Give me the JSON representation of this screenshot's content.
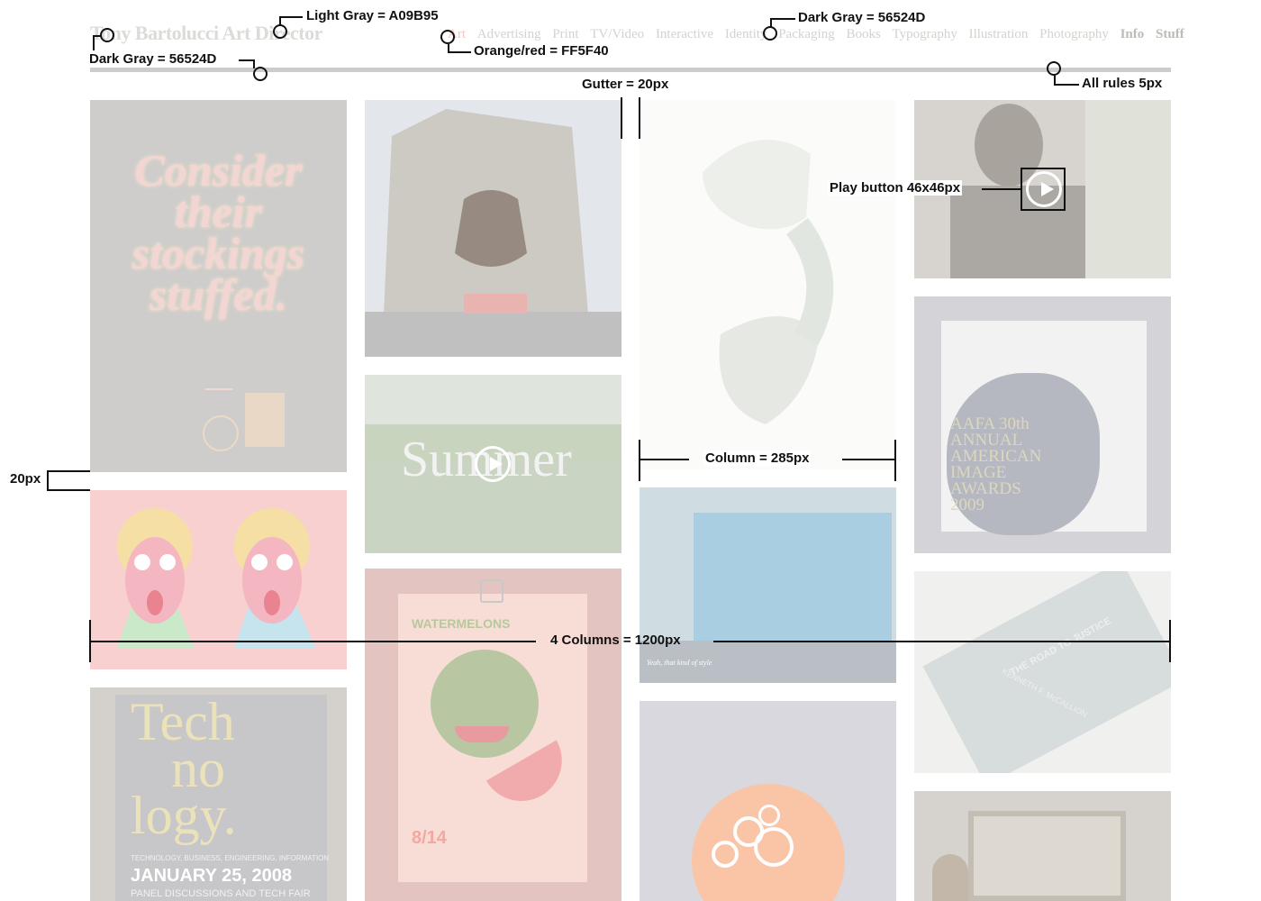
{
  "header": {
    "site_title": "Tony Bartolucci Art Director",
    "nav": [
      {
        "label": "Art"
      },
      {
        "label": "Advertising"
      },
      {
        "label": "Print"
      },
      {
        "label": "TV/Video"
      },
      {
        "label": "Interactive"
      },
      {
        "label": "Identity"
      },
      {
        "label": "Packaging"
      },
      {
        "label": "Books"
      },
      {
        "label": "Typography"
      },
      {
        "label": "Illustration"
      },
      {
        "label": "Photography"
      },
      {
        "label": "Info"
      },
      {
        "label": "Stuff"
      }
    ]
  },
  "tiles": {
    "lights": {
      "line1": "Consider",
      "line2": "their",
      "line3": "stockings",
      "line4": "stuffed."
    },
    "summer": {
      "caption": "Summer"
    },
    "tech": {
      "line1": "Tech",
      "line2": "no",
      "line3": "logy.",
      "sub": "TECHNOLOGY, BUSINESS, ENGINEERING, INFORMATION",
      "date": "JANUARY 25, 2008",
      "footer": "PANEL DISCUSSIONS AND TECH FAIR"
    },
    "melon": {
      "title": "WATERMELONS",
      "date": "8/14"
    },
    "aquarium": {
      "caption": "Yeah, that kind of style"
    },
    "aafa": {
      "line1": "AAFA 30th",
      "line2": "ANNUAL",
      "line3": "AMERICAN",
      "line4": "IMAGE",
      "line5": "AWARDS",
      "line6": "2009"
    },
    "book": {
      "title": "THE ROAD TO JUSTICE",
      "author": "KENNETH F. McCALLION"
    }
  },
  "annotations": {
    "light_gray": "Light Gray = A09B95",
    "dark_gray_top": "Dark Gray = 56524D",
    "dark_gray_left": "Dark Gray = 56524D",
    "orange_red": "Orange/red = FF5F40",
    "all_rules": "All rules 5px",
    "gutter": "Gutter = 20px",
    "play_button": "Play button 46x46px",
    "row_gap": "20px",
    "column": "Column = 285px",
    "four_columns": "4 Columns = 1200px"
  },
  "colors": {
    "light_gray": "#A09B95",
    "dark_gray": "#56524D",
    "orange_red": "#FF5F40"
  }
}
